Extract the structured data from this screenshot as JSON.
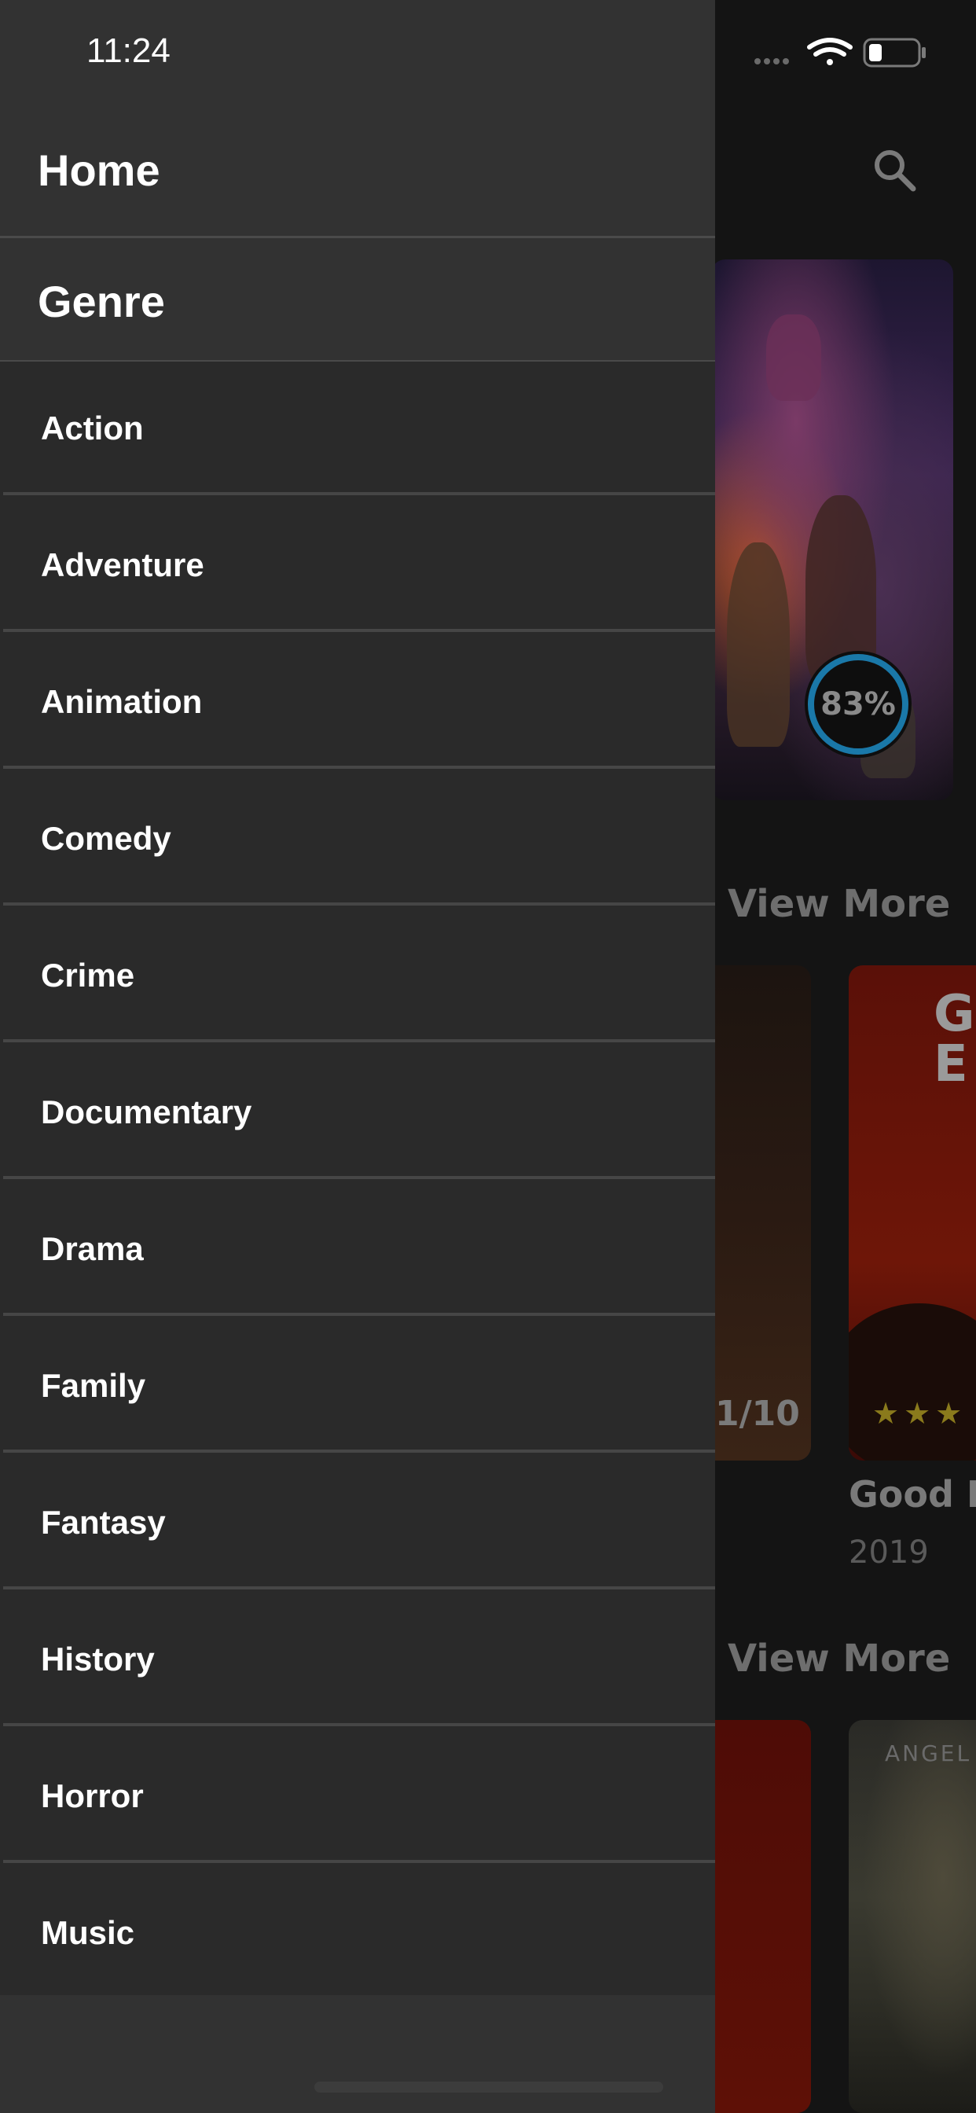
{
  "status_bar": {
    "time": "11:24"
  },
  "drawer": {
    "home_label": "Home",
    "genre_header": "Genre",
    "genres": [
      "Action",
      "Adventure",
      "Animation",
      "Comedy",
      "Crime",
      "Documentary",
      "Drama",
      "Family",
      "Fantasy",
      "History",
      "Horror",
      "Music"
    ]
  },
  "background": {
    "featured_rating": "83%",
    "view_more_1": "View More",
    "view_more_2": "View More",
    "card_score": "1/10",
    "card_title": "Good B",
    "card_year": "2019",
    "poster_letters": "G\nE",
    "poster_label": "ANGEL"
  },
  "colors": {
    "accent_ring": "#1a78a8",
    "drawer_bg": "#323232",
    "list_bg": "#2a2a2a"
  }
}
